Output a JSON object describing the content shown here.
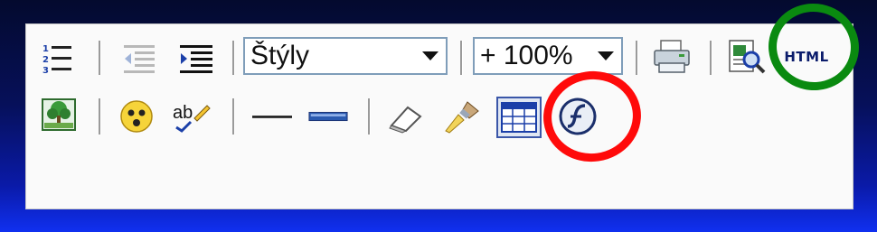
{
  "toolbar": {
    "row1": {
      "numbered_list_icon": "numbered-list-icon",
      "outdent_icon": "outdent-icon",
      "indent_icon": "indent-icon",
      "style_select": {
        "value": "Štýly"
      },
      "zoom_select": {
        "value": "+ 100%"
      },
      "print_icon": "printer-icon",
      "preview_icon": "preview-icon",
      "html_button": {
        "label": "HTML"
      }
    },
    "row2": {
      "image_icon": "image-icon",
      "smiley_icon": "smiley-icon",
      "spellcheck_icon": "spellcheck-icon",
      "hr_icon": "horizontal-rule-icon",
      "field_icon": "input-field-icon",
      "eraser_icon": "eraser-icon",
      "brush_icon": "format-brush-icon",
      "table_icon": "table-icon",
      "flash_icon": "flash-icon"
    }
  },
  "annotations": {
    "red_circle_color": "#ff0a0a",
    "green_circle_color": "#0a8a10"
  },
  "colors": {
    "panel": "#fafafa",
    "accent": "#1b3fa8"
  }
}
